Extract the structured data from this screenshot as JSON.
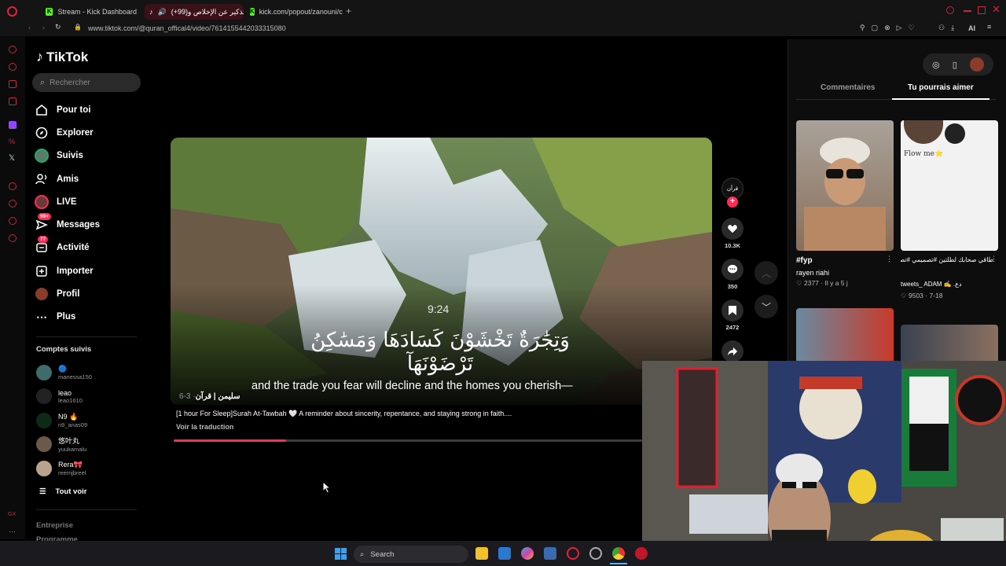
{
  "browser": {
    "tabs": [
      {
        "label": "Stream - Kick Dashboard"
      },
      {
        "label": "(+99)اتذكير عن الإخلاص و"
      },
      {
        "label": "kick.com/popout/zanouni/c"
      }
    ],
    "url": "www.tiktok.com/@quran_offical4/video/7614155442033315080",
    "ai_label": "AI"
  },
  "tiktok": {
    "logo": "TikTok",
    "search_placeholder": "Rechercher",
    "nav": [
      {
        "label": "Pour toi",
        "icon": "home-icon"
      },
      {
        "label": "Explorer",
        "icon": "compass-icon"
      },
      {
        "label": "Suivis",
        "icon": "following-avatar-icon"
      },
      {
        "label": "Amis",
        "icon": "friends-icon"
      },
      {
        "label": "LIVE",
        "icon": "live-icon"
      },
      {
        "label": "Messages",
        "icon": "messages-icon",
        "badge": "99+"
      },
      {
        "label": "Activité",
        "icon": "activity-icon",
        "badge": "77"
      },
      {
        "label": "Importer",
        "icon": "upload-icon"
      },
      {
        "label": "Profil",
        "icon": "profile-icon"
      },
      {
        "label": "Plus",
        "icon": "more-icon"
      }
    ],
    "following_title": "Comptes suivis",
    "following": [
      {
        "name": "🔵",
        "handle": "manessa150"
      },
      {
        "name": "leao",
        "handle": "leao1610"
      },
      {
        "name": "N9 🔥",
        "handle": "n9_anas09"
      },
      {
        "name": "悠叶丸",
        "handle": "yuukamalu"
      },
      {
        "name": "Rera🎀",
        "handle": "reemjbreel"
      }
    ],
    "see_all": "Tout voir",
    "footer": [
      "Entreprise",
      "Programme"
    ]
  },
  "video": {
    "timer": "9:24",
    "arabic_caption": "وَتِجَٰرَةٌ تَخْشَوْنَ كَسَادَهَا وَمَسَٰكِنُ تَرْضَوْنَهَآ",
    "subtitle": "and the trade you fear will decline and the homes you cherish—",
    "author": "سليمن | قرآن",
    "date": "· 3-6",
    "description": "[1 hour For Sleep]Surah At-Tawbah 🤍 A reminder about sincerity, repentance, and staying strong in faith....",
    "translate": "Voir la traduction",
    "progress": 0.24,
    "likes": "10.3K",
    "comments": "350",
    "saves": "2472",
    "avatar_text": "قرآن"
  },
  "right_panel": {
    "tabs": [
      "Commentaires",
      "Tu pourrais aimer"
    ],
    "cards": [
      {
        "title": "#fyp",
        "author": "rayen riahi",
        "likes": "2377",
        "date": "Il y a 5 j"
      },
      {
        "title": "طاقي صحابك لطلتين #تصميمي #تصميم_فيديوهات 🎬 🎤 🎶",
        "author": "tweets_ ADAM ✍️ .دع",
        "likes": "9503",
        "date": "7-18",
        "overlay": "Flow me⭐"
      }
    ]
  },
  "taskbar": {
    "search": "Search"
  },
  "colors": {
    "accent": "#fe2c55",
    "background": "#000000"
  }
}
